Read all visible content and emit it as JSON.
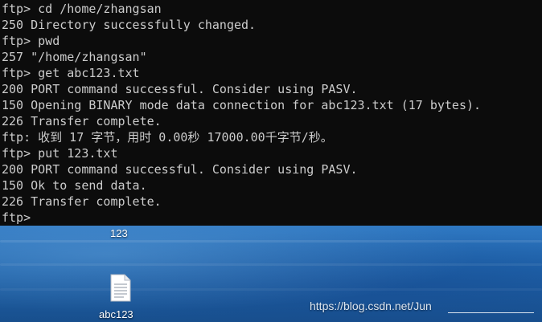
{
  "terminal": {
    "lines": [
      "ftp> cd /home/zhangsan",
      "250 Directory successfully changed.",
      "ftp> pwd",
      "257 \"/home/zhangsan\"",
      "ftp> get abc123.txt",
      "200 PORT command successful. Consider using PASV.",
      "150 Opening BINARY mode data connection for abc123.txt (17 bytes).",
      "226 Transfer complete.",
      "ftp: 收到 17 字节，用时 0.00秒 17000.00千字节/秒。",
      "ftp> put 123.txt",
      "200 PORT command successful. Consider using PASV.",
      "150 Ok to send data.",
      "226 Transfer complete.",
      "ftp>"
    ]
  },
  "desktop": {
    "folder_label": "123",
    "file_label": "abc123",
    "file_icon": "text-file-icon"
  },
  "watermark": {
    "text": "https://blog.csdn.net/Jun"
  },
  "colors": {
    "terminal_bg": "#0c0c0c",
    "terminal_fg": "#cccccc"
  }
}
